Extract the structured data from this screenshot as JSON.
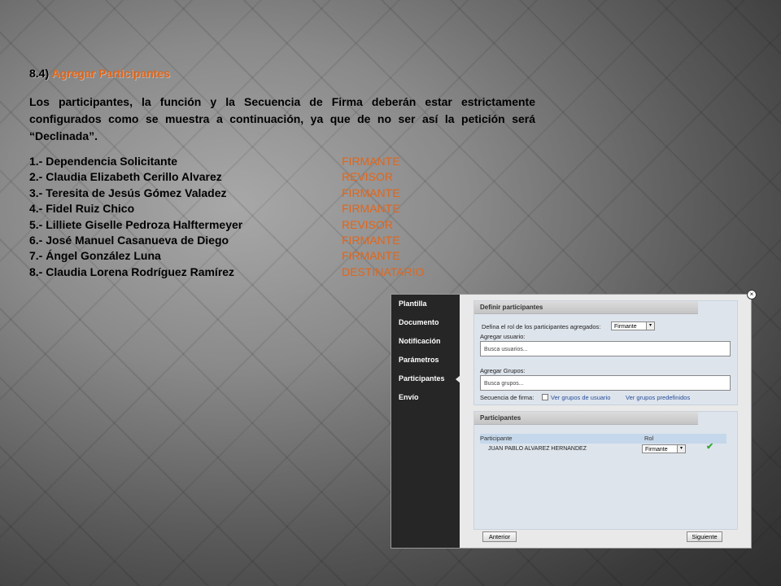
{
  "section": {
    "number": "8.4)",
    "title": "Agregar Participantes"
  },
  "paragraph": "Los participantes, la función y la Secuencia de Firma deberán estar estrictamente configurados como se muestra a continuación, ya que de no ser así la petición será “Declinada”.",
  "participants_list": [
    {
      "name": "1.- Dependencia Solicitante",
      "role": "FIRMANTE"
    },
    {
      "name": "2.- Claudia Elizabeth Cerillo Alvarez",
      "role": "REVISOR"
    },
    {
      "name": "3.- Teresita de Jesús Gómez Valadez",
      "role": "FIRMANTE"
    },
    {
      "name": "4.- Fidel Ruiz Chico",
      "role": "FIRMANTE"
    },
    {
      "name": "5.- Lilliete Giselle Pedroza Halftermeyer",
      "role": "REVISOR"
    },
    {
      "name": "6.- José Manuel Casanueva de Diego",
      "role": "FIRMANTE"
    },
    {
      "name": "7.- Ángel González Luna",
      "role": "FIRMANTE"
    },
    {
      "name": "8.- Claudia Lorena Rodríguez Ramírez",
      "role": "DESTINATARIO"
    }
  ],
  "screenshot": {
    "sidebar": [
      {
        "label": "Plantilla"
      },
      {
        "label": "Documento"
      },
      {
        "label": "Notificación"
      },
      {
        "label": "Parámetros"
      },
      {
        "label": "Participantes"
      },
      {
        "label": "Envío"
      }
    ],
    "define": {
      "title": "Definir participantes",
      "role_label": "Defina el rol de los participantes agregados:",
      "role_value": "Firmante",
      "user_label": "Agregar usuario:",
      "user_placeholder": "Busca usuarios...",
      "groups_label": "Agregar Grupos:",
      "groups_placeholder": "Busca grupos...",
      "sequence_label": "Secuencia de firma:",
      "link_user_groups": "Ver grupos de usuario",
      "link_predefined": "Ver grupos predefinidos"
    },
    "participants": {
      "title": "Participantes",
      "col_participant": "Participante",
      "col_role": "Rol",
      "rows": [
        {
          "name": "JUAN PABLO ALVAREZ HERNANDEZ",
          "role": "Firmante"
        }
      ]
    },
    "buttons": {
      "previous": "Anterior",
      "next": "Siguiente"
    }
  },
  "colors": {
    "accent": "#e0661b",
    "sidebar": "#262626",
    "link": "#2a4f9c"
  }
}
